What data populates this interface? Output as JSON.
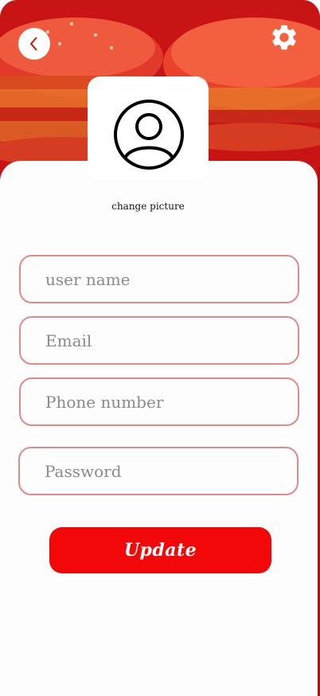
{
  "colors": {
    "hero_red": "#c81414",
    "button_red": "#f20808",
    "field_border": "#e08a8a",
    "card_bg": "#fdfdfd"
  },
  "icons": {
    "back": "chevron-left-icon",
    "settings": "gear-icon",
    "avatar": "user-circle-icon"
  },
  "profile": {
    "change_picture": "change picture"
  },
  "form": {
    "username_placeholder": "user name",
    "email_placeholder": "Email",
    "phone_placeholder": "Phone number",
    "password_placeholder": "Password",
    "update_label": "Update"
  }
}
